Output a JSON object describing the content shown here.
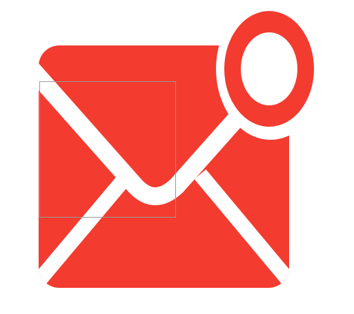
{
  "icon": {
    "name": "mail-notification-icon",
    "color": "#F33B30",
    "background": "#FFFFFF"
  },
  "selection": {
    "visible": true,
    "border_color": "#999999"
  }
}
